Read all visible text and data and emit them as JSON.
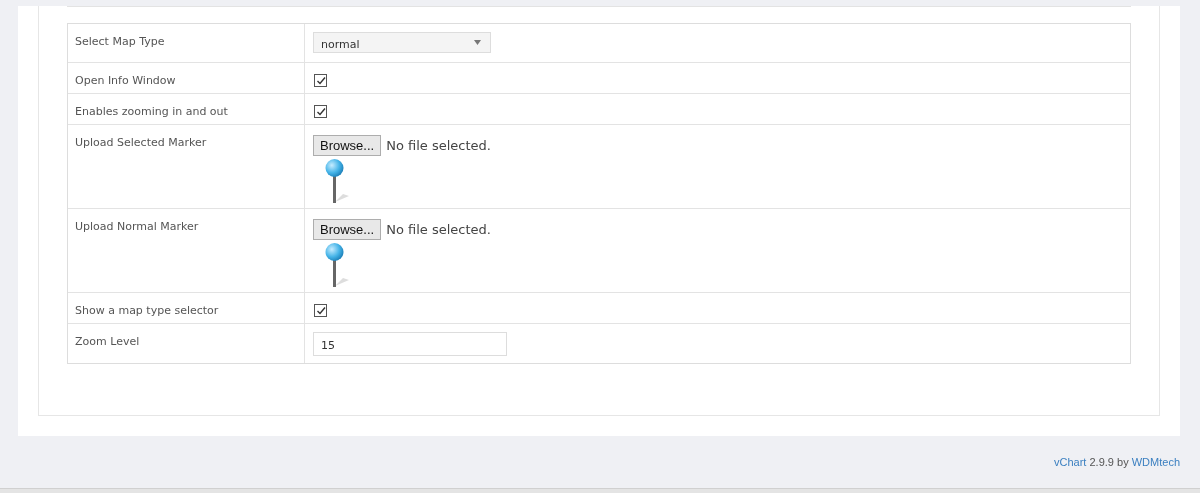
{
  "settings": [
    {
      "kind": "select",
      "label": "Select Map Type",
      "value": "normal"
    },
    {
      "kind": "checkbox",
      "label": "Open Info Window",
      "checked": true
    },
    {
      "kind": "checkbox",
      "label": "Enables zooming in and out",
      "checked": true
    },
    {
      "kind": "file",
      "label": "Upload Selected Marker",
      "button": "Browse...",
      "status": "No file selected."
    },
    {
      "kind": "file",
      "label": "Upload Normal Marker",
      "button": "Browse...",
      "status": "No file selected."
    },
    {
      "kind": "checkbox",
      "label": "Show a map type selector",
      "checked": true
    },
    {
      "kind": "text",
      "label": "Zoom Level",
      "value": "15"
    }
  ],
  "footer": {
    "product": "vChart",
    "version": "2.9.9",
    "by": "by",
    "vendor": "WDMtech"
  }
}
